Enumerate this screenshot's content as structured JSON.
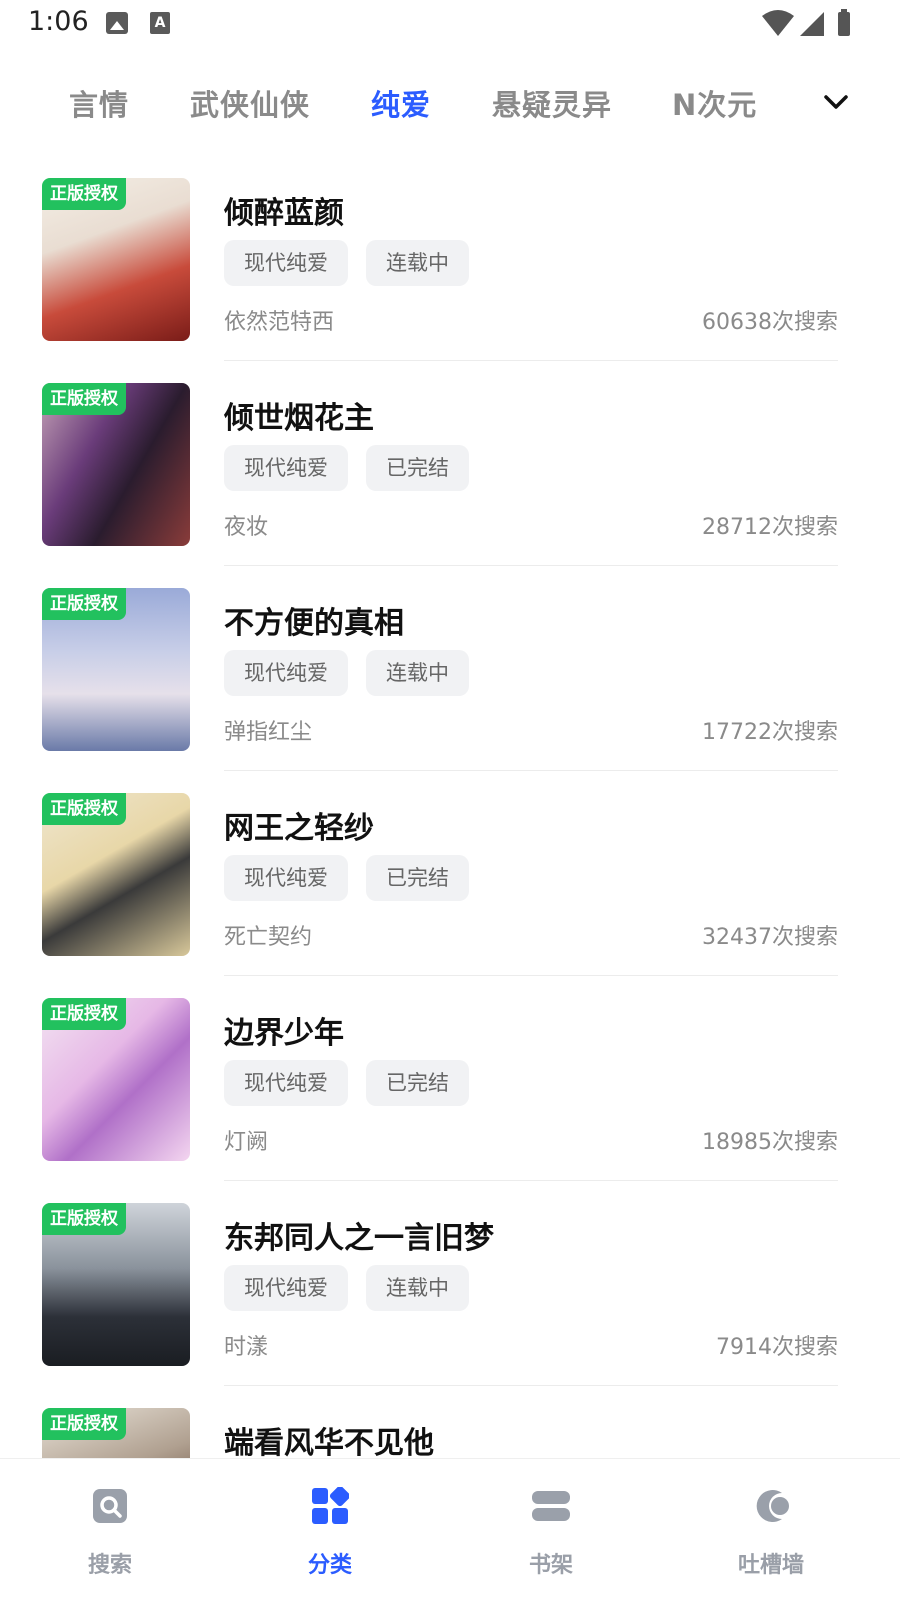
{
  "status_bar": {
    "time": "1:06"
  },
  "tabs": [
    {
      "label": "言情"
    },
    {
      "label": "武侠仙侠"
    },
    {
      "label": "纯爱"
    },
    {
      "label": "悬疑灵异"
    },
    {
      "label": "N次元"
    }
  ],
  "active_tab_index": 2,
  "colors": {
    "accent": "#2b5cff",
    "badge": "#22c15e",
    "tag_bg": "#f1f2f4"
  },
  "books": [
    {
      "title": "倾醉蓝颜",
      "badge": "正版授权",
      "genre": "现代纯爱",
      "status": "连载中",
      "author": "依然范特西",
      "searches": "60638次搜索"
    },
    {
      "title": "倾世烟花主",
      "badge": "正版授权",
      "genre": "现代纯爱",
      "status": "已完结",
      "author": "夜妆",
      "searches": "28712次搜索"
    },
    {
      "title": "不方便的真相",
      "badge": "正版授权",
      "genre": "现代纯爱",
      "status": "连载中",
      "author": "弹指红尘",
      "searches": "17722次搜索"
    },
    {
      "title": "网王之轻纱",
      "badge": "正版授权",
      "genre": "现代纯爱",
      "status": "已完结",
      "author": "死亡契约",
      "searches": "32437次搜索"
    },
    {
      "title": "边界少年",
      "badge": "正版授权",
      "genre": "现代纯爱",
      "status": "已完结",
      "author": "灯阙",
      "searches": "18985次搜索"
    },
    {
      "title": "东邦同人之一言旧梦",
      "badge": "正版授权",
      "genre": "现代纯爱",
      "status": "连载中",
      "author": "时漾",
      "searches": "7914次搜索"
    },
    {
      "title": "端看风华不见他",
      "badge": "正版授权",
      "genre": "",
      "status": "",
      "author": "",
      "searches": ""
    }
  ],
  "bottom_nav": [
    {
      "label": "搜索",
      "icon": "search-icon"
    },
    {
      "label": "分类",
      "icon": "category-icon"
    },
    {
      "label": "书架",
      "icon": "bookshelf-icon"
    },
    {
      "label": "吐槽墙",
      "icon": "comment-wall-icon"
    }
  ],
  "active_nav_index": 1
}
